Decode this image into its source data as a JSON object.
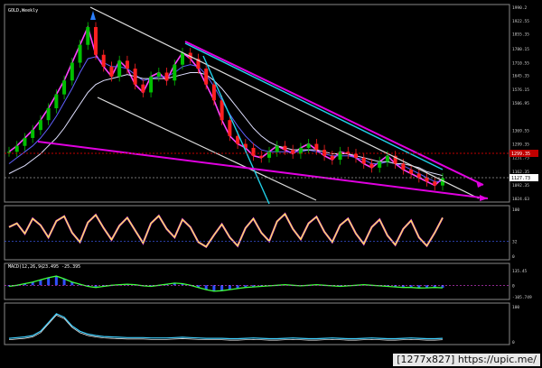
{
  "chart_data": [
    {
      "type": "line",
      "panel": "price",
      "title": "GOLD,Weekly",
      "ylim": [
        1824.63,
        1990.2
      ],
      "y_ticks": [
        1990.2,
        1922.55,
        1855.35,
        1780.15,
        1710.55,
        1645.35,
        1576.15,
        1506.95,
        1369.55,
        1299.35,
        1231.75,
        1162.35,
        1092.35,
        1024.63
      ],
      "current_price_label": "1127.73",
      "red_level_label": "1299.35",
      "series": [
        {
          "values": [
            1260,
            1290,
            1330,
            1370,
            1420,
            1480,
            1550,
            1620,
            1710,
            1800,
            1890,
            1750,
            1690,
            1640,
            1720,
            1680,
            1600,
            1560,
            1640,
            1660,
            1620,
            1700,
            1760,
            1730,
            1680,
            1600,
            1520,
            1420,
            1340,
            1300,
            1280,
            1240,
            1230,
            1260,
            1290,
            1270,
            1250,
            1280,
            1300,
            1270,
            1240,
            1220,
            1260,
            1250,
            1230,
            1200,
            1180,
            1210,
            1240,
            1200,
            1170,
            1150,
            1130,
            1110,
            1090,
            1127
          ]
        },
        {
          "values": [
            1200,
            1230,
            1260,
            1290,
            1330,
            1380,
            1440,
            1510,
            1580,
            1660,
            1730,
            1740,
            1710,
            1690,
            1690,
            1680,
            1650,
            1620,
            1630,
            1640,
            1640,
            1660,
            1690,
            1700,
            1690,
            1650,
            1590,
            1520,
            1450,
            1390,
            1340,
            1300,
            1270,
            1260,
            1260,
            1260,
            1260,
            1260,
            1270,
            1260,
            1250,
            1240,
            1240,
            1240,
            1230,
            1220,
            1200,
            1200,
            1210,
            1200,
            1190,
            1170,
            1150,
            1130,
            1110,
            1110
          ]
        },
        {
          "values": [
            1150,
            1170,
            1190,
            1220,
            1250,
            1290,
            1330,
            1380,
            1440,
            1500,
            1560,
            1600,
            1620,
            1630,
            1640,
            1650,
            1640,
            1630,
            1630,
            1630,
            1630,
            1640,
            1650,
            1660,
            1660,
            1650,
            1620,
            1580,
            1530,
            1480,
            1430,
            1380,
            1340,
            1310,
            1290,
            1280,
            1270,
            1270,
            1270,
            1270,
            1260,
            1250,
            1250,
            1250,
            1240,
            1230,
            1220,
            1210,
            1210,
            1200,
            1200,
            1190,
            1180,
            1160,
            1150,
            1140
          ]
        }
      ]
    },
    {
      "type": "line",
      "panel": "oscillator",
      "ylim": [
        0,
        100
      ],
      "y_ticks": [
        100,
        32,
        0
      ],
      "values": [
        62,
        70,
        48,
        80,
        66,
        40,
        75,
        85,
        50,
        30,
        72,
        88,
        60,
        35,
        65,
        82,
        55,
        28,
        70,
        86,
        58,
        40,
        78,
        62,
        30,
        20,
        45,
        68,
        40,
        22,
        60,
        80,
        50,
        32,
        74,
        90,
        58,
        36,
        70,
        84,
        52,
        30,
        66,
        80,
        48,
        26,
        62,
        78,
        44,
        24,
        58,
        76,
        40,
        22,
        50,
        82
      ]
    },
    {
      "type": "line",
      "panel": "macd",
      "title": "MACD(12,26,9)",
      "values_label": "-23.495 -25.395",
      "ylim": [
        -105.749,
        135.45
      ],
      "y_ticks": [
        135.45,
        0,
        -105.749
      ],
      "values": [
        -10,
        0,
        15,
        30,
        50,
        70,
        85,
        60,
        30,
        10,
        -10,
        -20,
        -10,
        0,
        5,
        10,
        5,
        -5,
        -10,
        0,
        10,
        20,
        15,
        0,
        -20,
        -40,
        -55,
        -50,
        -40,
        -30,
        -20,
        -15,
        -10,
        -5,
        0,
        5,
        0,
        -5,
        0,
        5,
        0,
        -5,
        -10,
        -5,
        0,
        5,
        0,
        -5,
        -10,
        -15,
        -20,
        -20,
        -25,
        -23,
        -20,
        -23
      ]
    },
    {
      "type": "line",
      "panel": "lower",
      "ylim": [
        0,
        100
      ],
      "y_ticks": [
        100,
        0
      ],
      "values": [
        10,
        12,
        14,
        18,
        30,
        55,
        80,
        70,
        45,
        30,
        22,
        18,
        15,
        14,
        13,
        12,
        12,
        12,
        11,
        11,
        11,
        12,
        13,
        12,
        11,
        10,
        10,
        10,
        9,
        9,
        10,
        11,
        10,
        9,
        9,
        10,
        11,
        10,
        9,
        9,
        10,
        11,
        10,
        9,
        9,
        10,
        11,
        10,
        9,
        9,
        10,
        11,
        10,
        9,
        9,
        10
      ]
    }
  ],
  "watermark": "[1277x827] https://upic.me/",
  "colors": {
    "background": "#000000",
    "candle_up": "#00c000",
    "candle_down": "#ff2020",
    "trend_white": "#dcdcdc",
    "trend_magenta": "#e000e0",
    "trend_cyan": "#20d0e8",
    "osc_line": "#ffff40",
    "macd_line": "#40ff40",
    "red_level": "#c00000"
  }
}
